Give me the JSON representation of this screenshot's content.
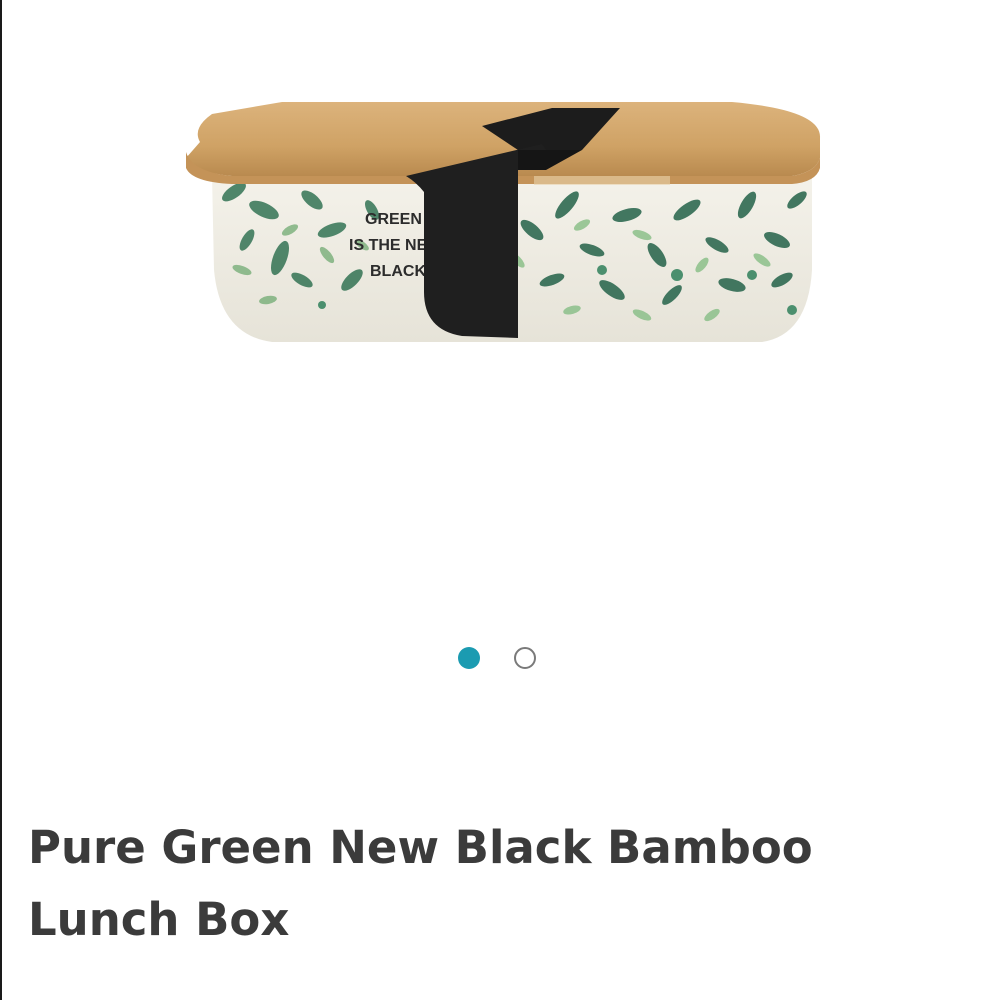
{
  "product": {
    "title": "Pure Green New Black Bamboo Lunch Box",
    "image": {
      "name": "bamboo-lunch-box-photo",
      "printed_text": [
        "GREEN",
        "IS THE NEW",
        "BLACK"
      ]
    }
  },
  "carousel": {
    "total_slides": 2,
    "active_index": 0,
    "active_color": "#1b9bb1",
    "inactive_border_color": "#7a7a7a"
  },
  "colors": {
    "title_text": "#3b3b3b",
    "background": "#ffffff"
  }
}
